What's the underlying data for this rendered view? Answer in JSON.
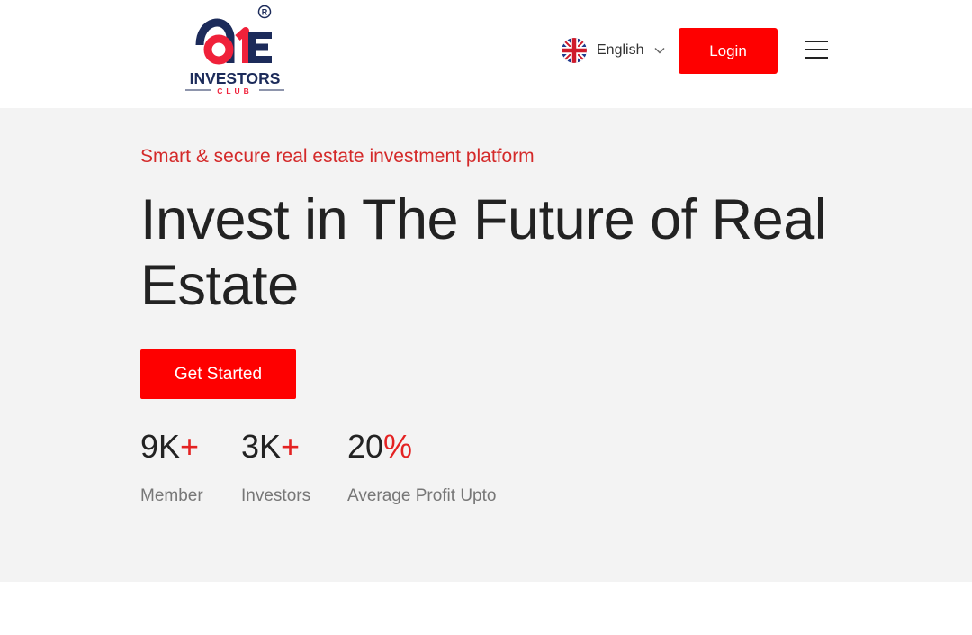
{
  "brand": {
    "logo_top": "ONE",
    "logo_middle": "INVESTORS",
    "logo_bottom": "CLUB",
    "registered_mark": "®"
  },
  "header": {
    "language": "English",
    "language_flag_icon": "uk-flag-icon",
    "dropdown_icon": "chevron-down-icon",
    "login_label": "Login",
    "menu_icon": "hamburger-menu-icon"
  },
  "hero": {
    "tagline": "Smart & secure real estate investment platform",
    "headline": "Invest in The Future of Real Estate",
    "cta_label": "Get Started",
    "stats": [
      {
        "value": "9K",
        "suffix": "+",
        "label": "Member"
      },
      {
        "value": "3K",
        "suffix": "+",
        "label": "Investors"
      },
      {
        "value": "20",
        "suffix": "%",
        "label": "Average Profit Upto"
      }
    ]
  },
  "colors": {
    "brand_red": "#fe0000",
    "accent_red": "#e42222",
    "brand_navy": "#1c2b5a",
    "hero_background": "#f3f3f3",
    "text_dark": "#222222",
    "text_muted": "#777777"
  }
}
